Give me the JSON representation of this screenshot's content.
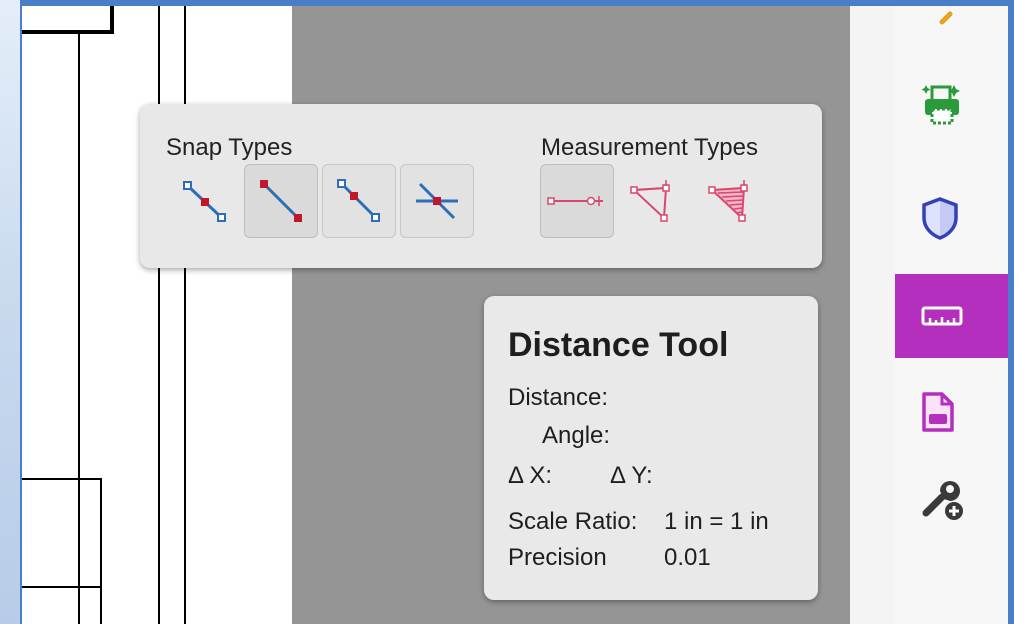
{
  "snap_panel": {
    "snap_title": "Snap Types",
    "measure_title": "Measurement Types",
    "snap_types": [
      {
        "icon": "snap-to-endpoint-icon"
      },
      {
        "icon": "snap-to-midpoint-icon"
      },
      {
        "icon": "snap-to-path-icon"
      },
      {
        "icon": "snap-to-intersection-icon"
      }
    ],
    "measurement_types": [
      {
        "icon": "distance-measure-icon"
      },
      {
        "icon": "perimeter-measure-icon"
      },
      {
        "icon": "area-measure-icon"
      }
    ]
  },
  "tool_card": {
    "title": "Distance Tool",
    "distance_label": "Distance:",
    "angle_label": "Angle:",
    "dx_label": "Δ X:",
    "dy_label": "Δ Y:",
    "scale_label": "Scale Ratio:",
    "scale_value": "1 in = 1 in",
    "precision_label": "Precision",
    "precision_value": "0.01"
  },
  "toolbar": {
    "items": [
      {
        "icon": "edit-pdf-icon"
      },
      {
        "icon": "print-production-icon"
      },
      {
        "icon": "protect-shield-icon"
      },
      {
        "icon": "measure-ruler-icon",
        "active": true
      },
      {
        "icon": "compress-pdf-icon"
      },
      {
        "icon": "more-tools-icon"
      }
    ]
  },
  "colors": {
    "active_tool": "#b52fbe",
    "accent_blue": "#2c6fb8",
    "snap_red": "#c0172a",
    "measure_pink": "#d9466e"
  }
}
